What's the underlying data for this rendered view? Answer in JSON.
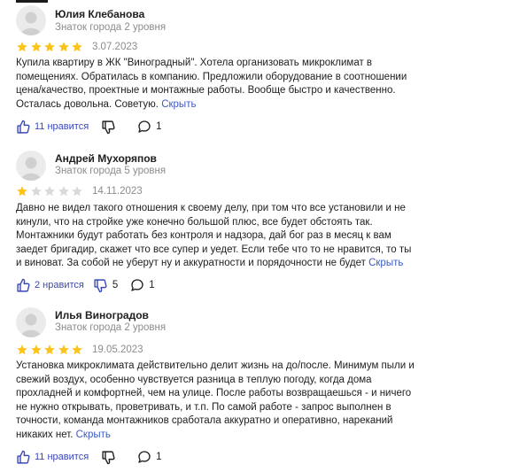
{
  "colors": {
    "star_filled": "#fcc419",
    "star_empty": "#d9d9d9",
    "link": "#3d5ac1",
    "action": "#3b48b8"
  },
  "reviews": [
    {
      "author": "Юлия Клебанова",
      "level": "Знаток города 2 уровня",
      "rating": 5,
      "date": "3.07.2023",
      "text": "Купила квартиру в ЖК \"Виноградный\". Хотела организовать микроклимат в помещениях. Обратилась в компанию. Предложили оборудование в соотношении цена/качество, проектные и монтажные работы. Вообще быстро и качественно. Осталась довольна. Советую.",
      "hide_label": "Скрыть",
      "likes_label": "11 нравится",
      "dislikes_count": "",
      "comments_count": "1"
    },
    {
      "author": "Андрей Мухоряпов",
      "level": "Знаток города 5 уровня",
      "rating": 1,
      "date": "14.11.2023",
      "text": "Давно не видел такого отношения к своему делу, при том что все установили и не кинули, что на стройке уже конечно большой плюс, все будет обстоять так. Монтажники будут работать без контроля и надзора, дай бог раз в месяц к вам заедет бригадир, скажет что все супер и уедет. Если тебе что то не нравится, то ты и виноват. За собой не уберут ну и аккуратности и порядочности не будет",
      "hide_label": "Скрыть",
      "likes_label": "2 нравится",
      "dislikes_count": "5",
      "comments_count": "1"
    },
    {
      "author": "Илья Виноградов",
      "level": "Знаток города 2 уровня",
      "rating": 5,
      "date": "19.05.2023",
      "text": "Установка микроклимата действительно делит жизнь на до/после. Минимум пыли и свежий воздух, особенно чувствуется разница в теплую погоду, когда дома прохладней и комфортней, чем на улице. После работы возвращаешься - и ничего не нужно открывать, проветривать, и т.п. По самой работе - запрос выполнен в точности, команда монтажников сработала аккуратно и оперативно, нареканий никаких нет.",
      "hide_label": "Скрыть",
      "likes_label": "11 нравится",
      "dislikes_count": "",
      "comments_count": "1"
    }
  ]
}
